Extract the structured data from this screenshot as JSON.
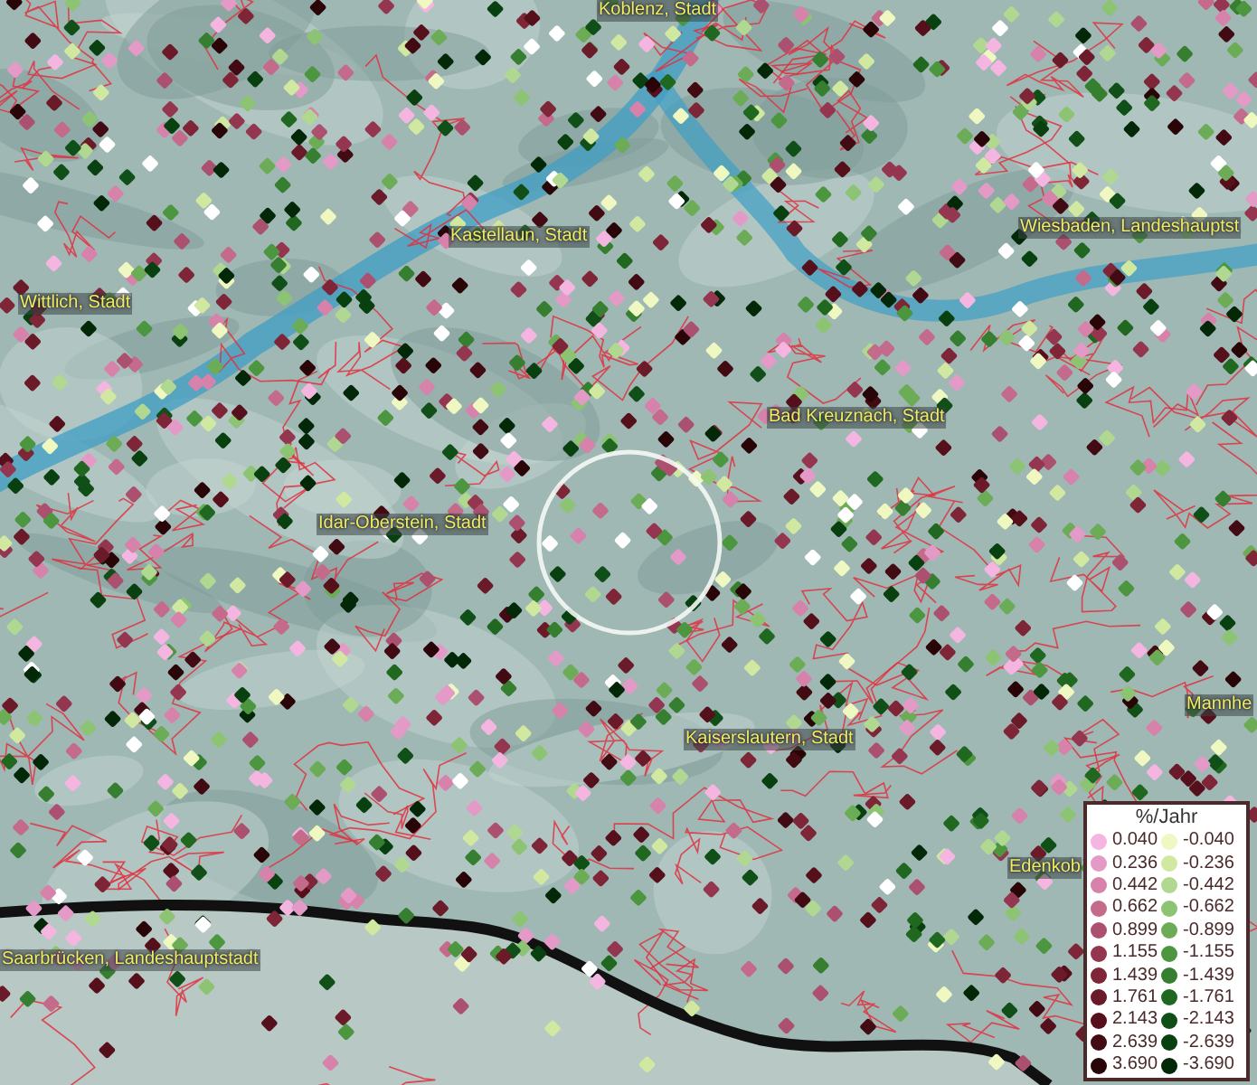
{
  "map_labels": [
    {
      "text": "Koblenz, Stadt"
    },
    {
      "text": "Kastellaun, Stadt"
    },
    {
      "text": "Wiesbaden, Landeshauptst"
    },
    {
      "text": "Wittlich, Stadt"
    },
    {
      "text": "Bad Kreuznach, Stadt"
    },
    {
      "text": "Idar-Oberstein, Stadt"
    },
    {
      "text": "Kaiserslautern, Stadt"
    },
    {
      "text": "Mannhe"
    },
    {
      "text": "Edenkob"
    },
    {
      "text": "Saarbrücken, Landeshauptstadt"
    }
  ],
  "legend": {
    "title": "%/Jahr",
    "positive": [
      {
        "value": "0.040",
        "color": "#f4b6e0"
      },
      {
        "value": "0.236",
        "color": "#e49ac6"
      },
      {
        "value": "0.442",
        "color": "#d682aa"
      },
      {
        "value": "0.662",
        "color": "#c46a8a"
      },
      {
        "value": "0.899",
        "color": "#ac5070"
      },
      {
        "value": "1.155",
        "color": "#953650"
      },
      {
        "value": "1.439",
        "color": "#7e2638"
      },
      {
        "value": "1.761",
        "color": "#6a1a28"
      },
      {
        "value": "2.143",
        "color": "#55101c"
      },
      {
        "value": "2.639",
        "color": "#420a12"
      },
      {
        "value": "3.690",
        "color": "#2a0508"
      }
    ],
    "negative": [
      {
        "value": "-0.040",
        "color": "#eef8c0"
      },
      {
        "value": "-0.236",
        "color": "#d0e8a0"
      },
      {
        "value": "-0.442",
        "color": "#b0d890"
      },
      {
        "value": "-0.662",
        "color": "#8cc474"
      },
      {
        "value": "-0.899",
        "color": "#6cac56"
      },
      {
        "value": "-1.155",
        "color": "#4c9640"
      },
      {
        "value": "-1.439",
        "color": "#367e30"
      },
      {
        "value": "-1.761",
        "color": "#206820"
      },
      {
        "value": "-2.143",
        "color": "#105018"
      },
      {
        "value": "-2.639",
        "color": "#084010"
      },
      {
        "value": "-3.690",
        "color": "#022808"
      }
    ]
  }
}
